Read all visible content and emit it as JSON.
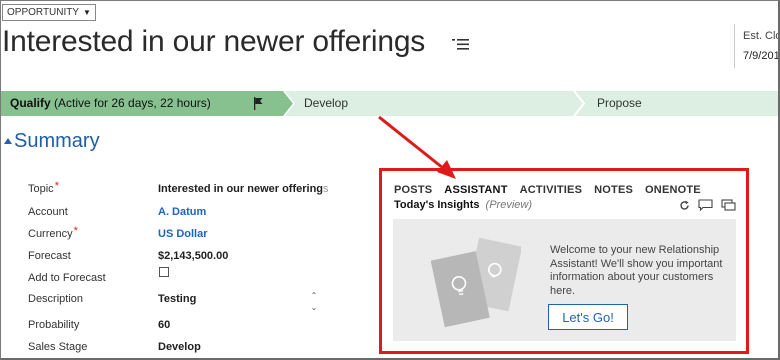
{
  "entity_type": "OPPORTUNITY",
  "title": "Interested in our newer offerings",
  "header_right": {
    "label": "Est. Clos",
    "value": "7/9/201"
  },
  "process": {
    "active_stage": "Qualify",
    "active_duration": "(Active for 26 days, 22 hours)",
    "stages": [
      "Develop",
      "Propose"
    ]
  },
  "summary_title": "Summary",
  "fields": [
    {
      "label": "Topic",
      "required": true,
      "value": "Interested in our newer offering",
      "value_fade": "s"
    },
    {
      "label": "Account",
      "required": false,
      "value": "A. Datum"
    },
    {
      "label": "Currency",
      "required": true,
      "value": "US Dollar"
    },
    {
      "label": "Forecast",
      "required": false,
      "value": "$2,143,500.00"
    },
    {
      "label": "Add to Forecast",
      "required": false,
      "value": ""
    },
    {
      "label": "Description",
      "required": false,
      "value": "Testing"
    },
    {
      "label": "Probability",
      "required": false,
      "value": "60"
    },
    {
      "label": "Sales Stage",
      "required": false,
      "value": "Develop"
    }
  ],
  "required_mark": "*",
  "assistant": {
    "tabs": [
      "POSTS",
      "ASSISTANT",
      "ACTIVITIES",
      "NOTES",
      "ONENOTE"
    ],
    "active_tab": "ASSISTANT",
    "insights_label": "Today's Insights",
    "preview_label": "(Preview)",
    "toolbar_icons": [
      "refresh-icon",
      "comment-icon",
      "cards-icon"
    ],
    "welcome_text": "Welcome to your new Relationship Assistant! We'll show you important information about your customers here.",
    "go_button": "Let's Go!"
  },
  "colors": {
    "active_stage": "#86c18f",
    "process_bar": "#dcefe2",
    "link": "#1f63b8",
    "highlight_border": "#e01a1a",
    "arrow": "#e01a1a"
  }
}
